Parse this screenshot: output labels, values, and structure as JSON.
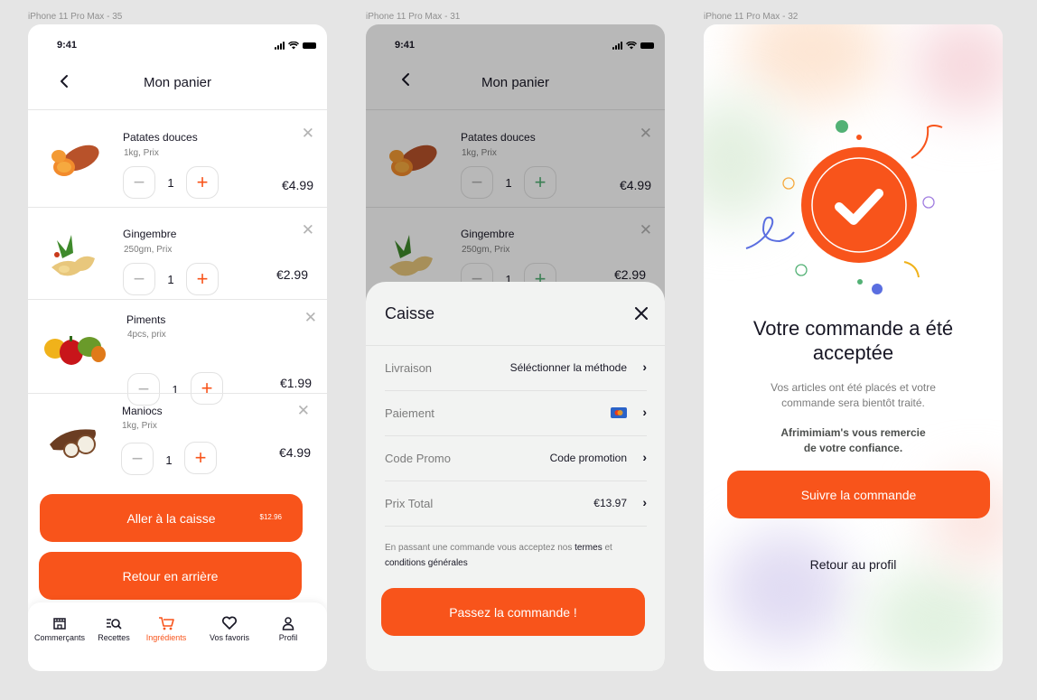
{
  "frames": {
    "f1": "iPhone 11 Pro Max - 35",
    "f2": "iPhone 11 Pro Max - 31",
    "f3": "iPhone 11 Pro Max - 32"
  },
  "status_time": "9:41",
  "cart": {
    "title": "Mon panier",
    "items": [
      {
        "name": "Patates douces",
        "sub": "1kg, Prix",
        "qty": "1",
        "price": "€4.99"
      },
      {
        "name": "Gingembre",
        "sub": "250gm, Prix",
        "qty": "1",
        "price": "€2.99"
      },
      {
        "name": "Piments",
        "sub": "4pcs, prix",
        "qty": "1",
        "price": "€1.99"
      },
      {
        "name": "Maniocs",
        "sub": "1kg,  Prix",
        "qty": "1",
        "price": "€4.99"
      }
    ],
    "checkout_label": "Aller à la caisse",
    "checkout_total": "$12.96",
    "back_label": "Retour en arrière"
  },
  "tabs": [
    "Commerçants",
    "Recettes",
    "Ingrédients",
    "Vos favoris",
    "Profil"
  ],
  "checkout": {
    "title": "Caisse",
    "rows": [
      {
        "label": "Livraison",
        "value": "Séléctionner la méthode"
      },
      {
        "label": "Paiement",
        "value": ""
      },
      {
        "label": "Code Promo",
        "value": "Code promotion"
      },
      {
        "label": "Prix Total",
        "value": "€13.97"
      }
    ],
    "terms_prefix": "En passant une commande vous acceptez nos ",
    "terms_link1": "termes",
    "terms_mid": " et ",
    "terms_link2": "conditions générales",
    "order_button": "Passez la commande !"
  },
  "success": {
    "title": "Votre commande a été acceptée",
    "message": "Vos articles ont été placés et votre commande sera bientôt traité.",
    "thanks": "Afrimimiam's vous remercie de votre confiance.",
    "track_button": "Suivre la commande",
    "profile_link": "Retour au profil"
  },
  "colors": {
    "accent": "#f8541b",
    "green": "#53b175"
  }
}
